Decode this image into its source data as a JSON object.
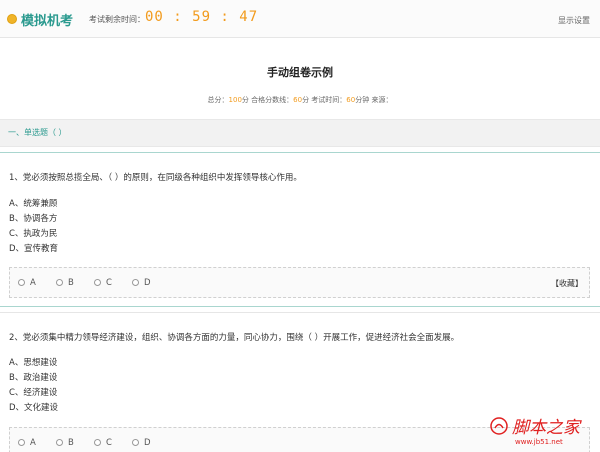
{
  "header": {
    "app_title": "模拟机考",
    "timer_label": "考试剩余时间：",
    "timer_value": "00 : 59 : 47",
    "settings_label": "显示设置"
  },
  "paper": {
    "title": "手动组卷示例",
    "info": {
      "total_label": "总分：",
      "total_value": "100",
      "total_unit": "分  合格分数线：",
      "pass_value": "60",
      "pass_unit": "分  考试时间：",
      "time_value": "60",
      "time_unit": "分钟  来源："
    }
  },
  "section": {
    "title": "一、单选题（ ）"
  },
  "questions": [
    {
      "stem": "1、党必须按照总揽全局、（ ）的原则，在同级各种组织中发挥领导核心作用。",
      "options": [
        "A、统筹兼顾",
        "B、协调各方",
        "C、执政为民",
        "D、宣传教育"
      ],
      "choices": [
        "A",
        "B",
        "C",
        "D"
      ],
      "collect_label": "【收藏】"
    },
    {
      "stem": "2、党必须集中精力领导经济建设，组织、协调各方面的力量，同心协力，围绕（ ）开展工作，促进经济社会全面发展。",
      "options": [
        "A、思想建设",
        "B、政治建设",
        "C、经济建设",
        "D、文化建设"
      ],
      "choices": [
        "A",
        "B",
        "C",
        "D"
      ]
    }
  ],
  "watermark": {
    "text": "脚本之家",
    "url": "www.jb51.net"
  },
  "colors": {
    "accent": "#2b9a8f",
    "timer": "#f29b1d",
    "watermark": "#e02020"
  }
}
